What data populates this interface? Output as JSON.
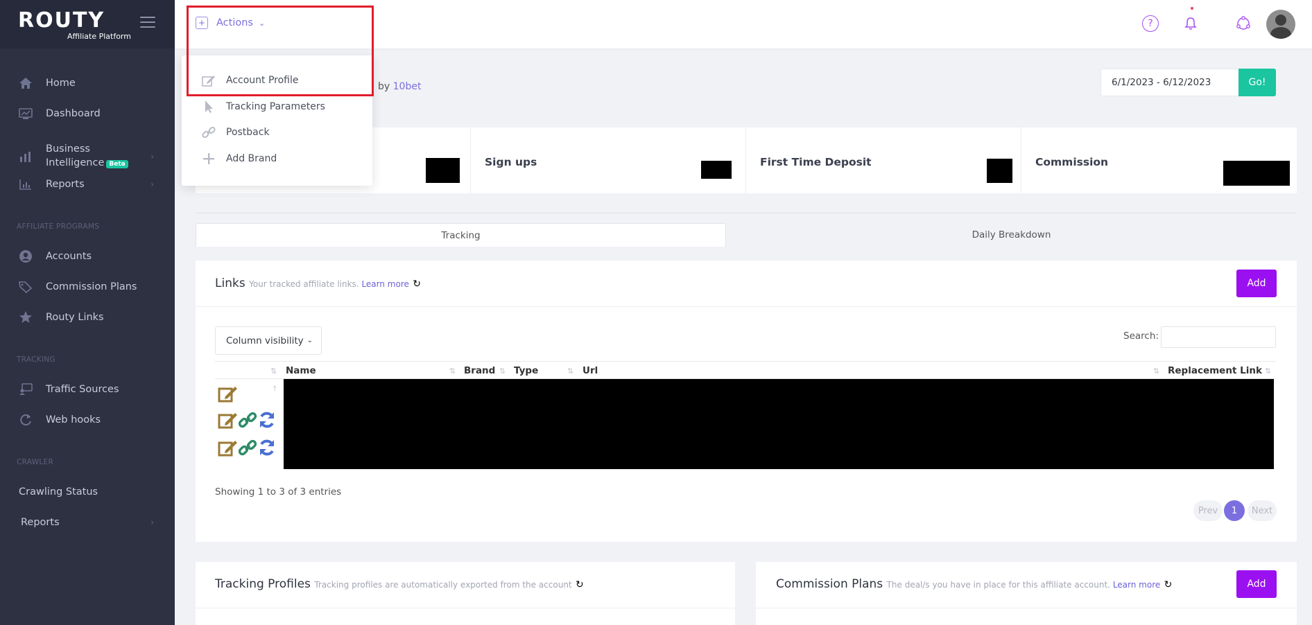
{
  "brand": {
    "logo": "ROUTY",
    "subtitle": "Affiliate Platform"
  },
  "sidebar": {
    "items": [
      {
        "label": "Home",
        "icon": "home-icon"
      },
      {
        "label": "Dashboard",
        "icon": "dashboard-icon"
      },
      {
        "label": "Business Intelligence",
        "line1": "Business",
        "line2": "Intelligence",
        "badge": "Beta",
        "icon": "bar-chart-icon"
      },
      {
        "label": "Reports",
        "icon": "reports-icon"
      }
    ],
    "sections": [
      {
        "title": "AFFILIATE PROGRAMS",
        "items": [
          {
            "label": "Accounts"
          },
          {
            "label": "Commission Plans"
          },
          {
            "label": "Routy Links"
          }
        ]
      },
      {
        "title": "TRACKING",
        "items": [
          {
            "label": "Traffic Sources"
          },
          {
            "label": "Web hooks"
          }
        ]
      },
      {
        "title": "CRAWLER",
        "items": [
          {
            "label": "Crawling Status"
          },
          {
            "label": "Reports"
          }
        ]
      }
    ]
  },
  "topbar": {
    "actions_label": "Actions"
  },
  "dropdown": {
    "items": [
      {
        "label": "Account Profile",
        "icon": "edit-icon"
      },
      {
        "label": "Tracking Parameters",
        "icon": "cursor-icon"
      },
      {
        "label": "Postback",
        "icon": "link-icon"
      },
      {
        "label": "Add Brand",
        "icon": "plus-icon"
      }
    ]
  },
  "header": {
    "by_prefix": "by",
    "by_brand": "10bet"
  },
  "date_filter": {
    "value": "6/1/2023 - 6/12/2023",
    "go_label": "Go!"
  },
  "stats": [
    {
      "label": ""
    },
    {
      "label": "Sign ups"
    },
    {
      "label": "First Time Deposit"
    },
    {
      "label": "Commission"
    }
  ],
  "tabs": [
    {
      "label": "Tracking"
    },
    {
      "label": "Daily Breakdown"
    }
  ],
  "links_card": {
    "title": "Links",
    "subtitle": "Your tracked affiliate links.",
    "learn_more": "Learn more",
    "add_label": "Add",
    "column_visibility": "Column visibility",
    "search_label": "Search:",
    "columns": [
      "Name",
      "Brand",
      "Type",
      "Url",
      "Replacement Link"
    ],
    "showing": "Showing 1 to 3 of 3 entries",
    "pagination": {
      "prev": "Prev",
      "current": "1",
      "next": "Next"
    }
  },
  "tracking_profiles": {
    "title": "Tracking Profiles",
    "subtitle": "Tracking profiles are automatically exported from the account"
  },
  "commission_plans": {
    "title": "Commission Plans",
    "subtitle": "The deal/s you have in place for this affiliate account.",
    "learn_more": "Learn more",
    "add_label": "Add"
  },
  "colors": {
    "sidebar": "#2d3142",
    "accent": "#7b6fe0",
    "purple_button": "#9b10f0",
    "go_button": "#1bc5a0",
    "highlight": "#e11d2c"
  }
}
